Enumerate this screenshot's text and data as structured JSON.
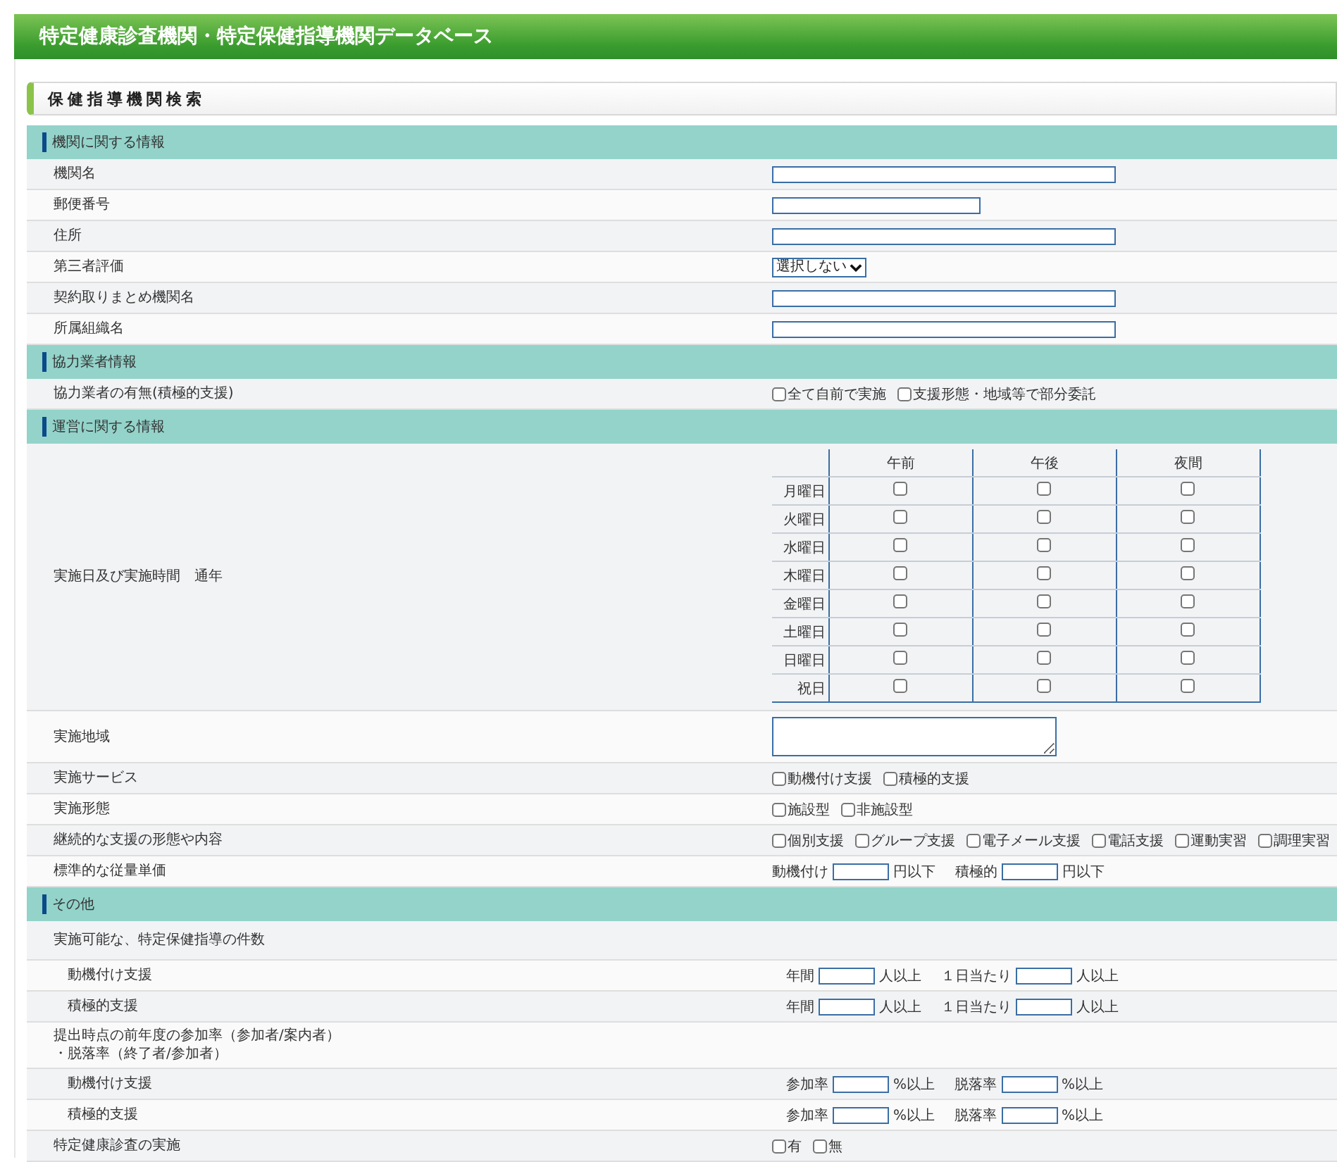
{
  "header": {
    "title": "特定健康診査機関・特定保健指導機関データベース"
  },
  "page_title": "保健指導機関検索",
  "sections": [
    {
      "title": "機関に関する情報",
      "rows": [
        {
          "label": "機関名",
          "kind": "widefield"
        },
        {
          "label": "郵便番号",
          "kind": "field"
        },
        {
          "label": "住所",
          "kind": "widefield"
        },
        {
          "label": "第三者評価",
          "kind": "select",
          "value": "選択しない"
        },
        {
          "label": "契約取りまとめ機関名",
          "kind": "widefield"
        },
        {
          "label": "所属組織名",
          "kind": "widefield"
        }
      ]
    },
    {
      "title": "協力業者情報",
      "rows": [
        {
          "label": "協力業者の有無(積極的支援)",
          "kind": "checks",
          "options": [
            {
              "label": "全て自前で実施",
              "checked": false
            },
            {
              "label": "支援形態・地域等で部分委託",
              "checked": false
            }
          ]
        }
      ]
    },
    {
      "title": "運営に関する情報",
      "rows": [
        {
          "label": "実施日及び実施時間　通年",
          "kind": "schedule",
          "columns": [
            "午前",
            "午後",
            "夜間"
          ],
          "days": [
            {
              "day": "月曜日",
              "checks": [
                false,
                false,
                false
              ]
            },
            {
              "day": "火曜日",
              "checks": [
                false,
                false,
                false
              ]
            },
            {
              "day": "水曜日",
              "checks": [
                false,
                false,
                false
              ]
            },
            {
              "day": "木曜日",
              "checks": [
                false,
                false,
                false
              ]
            },
            {
              "day": "金曜日",
              "checks": [
                false,
                false,
                false
              ]
            },
            {
              "day": "土曜日",
              "checks": [
                false,
                false,
                false
              ]
            },
            {
              "day": "日曜日",
              "checks": [
                false,
                false,
                false
              ]
            },
            {
              "day": "祝日",
              "checks": [
                false,
                false,
                false
              ]
            }
          ]
        },
        {
          "label": "実施地域",
          "kind": "textarea"
        },
        {
          "label": "実施サービス",
          "kind": "checks",
          "options": [
            {
              "label": "動機付け支援",
              "checked": false
            },
            {
              "label": "積極的支援",
              "checked": false
            }
          ]
        },
        {
          "label": "実施形態",
          "kind": "checks",
          "options": [
            {
              "label": "施設型",
              "checked": false
            },
            {
              "label": "非施設型",
              "checked": false
            }
          ]
        },
        {
          "label": "継続的な支援の形態や内容",
          "kind": "checks",
          "options": [
            {
              "label": "個別支援",
              "checked": false
            },
            {
              "label": "グループ支援",
              "checked": false
            },
            {
              "label": "電子メール支援",
              "checked": false
            },
            {
              "label": "電話支援",
              "checked": false
            },
            {
              "label": "運動実習",
              "checked": false
            },
            {
              "label": "調理実習",
              "checked": false
            }
          ]
        },
        {
          "label": "標準的な従量単価",
          "kind": "inline",
          "parts": [
            {
              "kind": "text",
              "text": "動機付け"
            },
            {
              "kind": "input"
            },
            {
              "kind": "text",
              "text": "円以下"
            },
            {
              "kind": "gap"
            },
            {
              "kind": "text",
              "text": "積極的"
            },
            {
              "kind": "input"
            },
            {
              "kind": "text",
              "text": "円以下"
            }
          ]
        }
      ]
    },
    {
      "title": "その他",
      "rows": [
        {
          "label": "実施可能な、特定保健指導の件数",
          "kind": "blank",
          "children": [
            {
              "label": "動機付け支援",
              "kind": "inline",
              "parts": [
                {
                  "kind": "text",
                  "text": "年間"
                },
                {
                  "kind": "input"
                },
                {
                  "kind": "text",
                  "text": "人以上"
                },
                {
                  "kind": "gap"
                },
                {
                  "kind": "text",
                  "text": "１日当たり"
                },
                {
                  "kind": "input"
                },
                {
                  "kind": "text",
                  "text": "人以上"
                }
              ]
            },
            {
              "label": "積極的支援",
              "kind": "inline",
              "parts": [
                {
                  "kind": "text",
                  "text": "年間"
                },
                {
                  "kind": "input"
                },
                {
                  "kind": "text",
                  "text": "人以上"
                },
                {
                  "kind": "gap"
                },
                {
                  "kind": "text",
                  "text": "１日当たり"
                },
                {
                  "kind": "input"
                },
                {
                  "kind": "text",
                  "text": "人以上"
                }
              ]
            }
          ]
        },
        {
          "label": "提出時点の前年度の参加率（参加者/案内者）・脱落率（終了者/参加者）",
          "kind": "blank",
          "children": [
            {
              "label": "動機付け支援",
              "kind": "inline",
              "parts": [
                {
                  "kind": "text",
                  "text": "参加率"
                },
                {
                  "kind": "input"
                },
                {
                  "kind": "text",
                  "text": "%以上"
                },
                {
                  "kind": "gap"
                },
                {
                  "kind": "text",
                  "text": "脱落率"
                },
                {
                  "kind": "input"
                },
                {
                  "kind": "text",
                  "text": "%以上"
                }
              ]
            },
            {
              "label": "積極的支援",
              "kind": "inline",
              "parts": [
                {
                  "kind": "text",
                  "text": "参加率"
                },
                {
                  "kind": "input"
                },
                {
                  "kind": "text",
                  "text": "%以上"
                },
                {
                  "kind": "gap"
                },
                {
                  "kind": "text",
                  "text": "脱落率"
                },
                {
                  "kind": "input"
                },
                {
                  "kind": "text",
                  "text": "%以上"
                }
              ]
            }
          ]
        },
        {
          "label": "特定健康診査の実施",
          "kind": "checks",
          "options": [
            {
              "label": "有",
              "checked": false
            },
            {
              "label": "無",
              "checked": false
            }
          ]
        }
      ]
    }
  ]
}
